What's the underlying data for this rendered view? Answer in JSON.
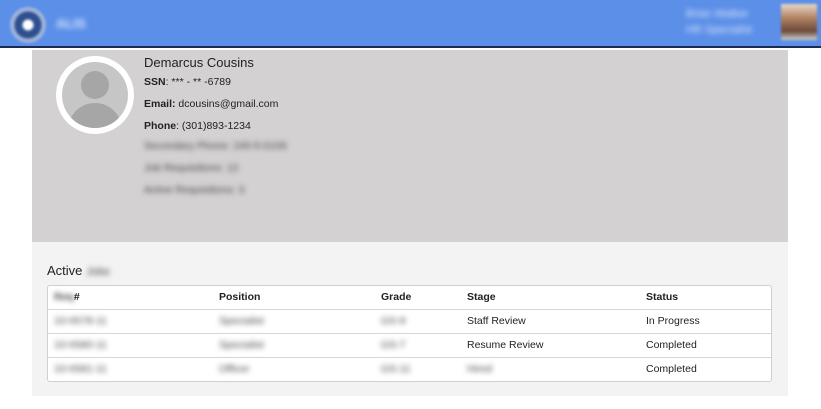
{
  "header": {
    "app_name": "ALIS",
    "user_name": "Brian Walker",
    "user_role": "HR Specialist"
  },
  "profile": {
    "name": "Demarcus Cousins",
    "ssn_label": "SSN",
    "ssn_value": ": *** - ** -6789",
    "email_label": "Email:",
    "email_value": " dcousins@gmail.com",
    "phone_label": "Phone",
    "phone_value": ": (301)893-1234",
    "blurred_lines": [
      "Secondary Phone: 240-5-5155",
      "Job Requisitions: 12",
      "Active Requisitions: 3"
    ]
  },
  "active_section": {
    "title": "Active",
    "title_suffix": "Jobs",
    "columns": {
      "req_prefix": "Req",
      "req": "#",
      "position": "Position",
      "grade": "Grade",
      "stage": "Stage",
      "status": "Status"
    },
    "rows": [
      {
        "req": "10-0578-11",
        "position": "Specialist",
        "grade": "GS-9",
        "stage": "Staff Review",
        "status": "In Progress"
      },
      {
        "req": "10-0580-11",
        "position": "Specialist",
        "grade": "GS-7",
        "stage": "Resume Review",
        "status": "Completed"
      },
      {
        "req": "10-0581-11",
        "position": "Officer",
        "grade": "GS-11",
        "stage": "Hired",
        "status": "Completed"
      }
    ]
  }
}
